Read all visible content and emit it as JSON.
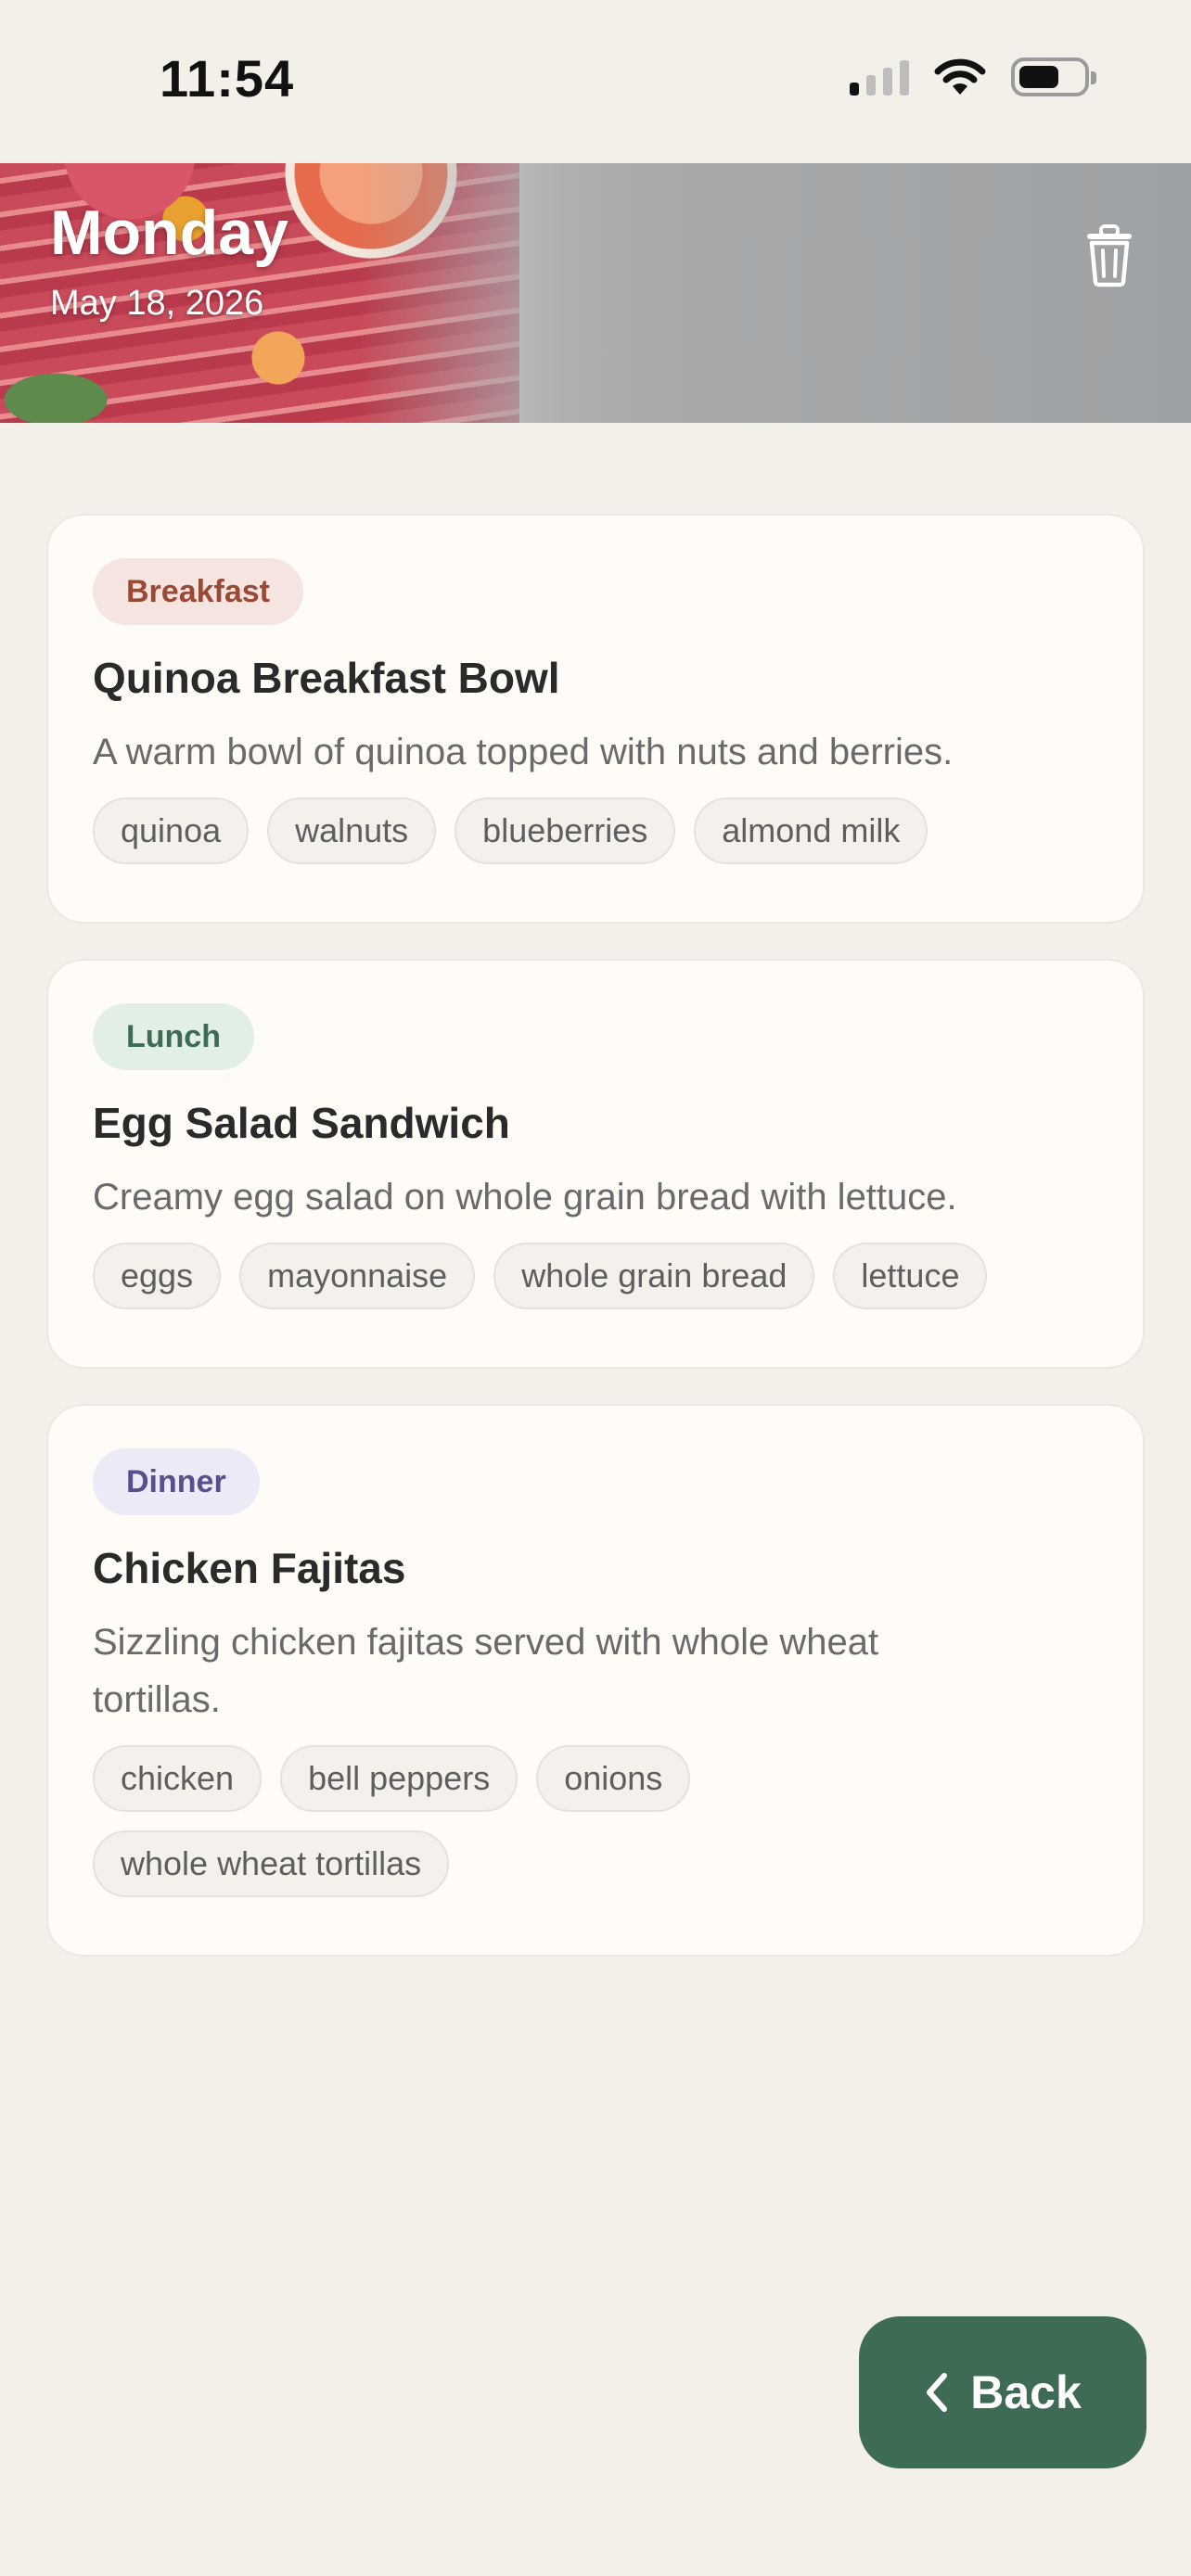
{
  "status_bar": {
    "time": "11:54"
  },
  "header": {
    "day": "Monday",
    "date": "May 18, 2026"
  },
  "meals": [
    {
      "type": "Breakfast",
      "title": "Quinoa Breakfast Bowl",
      "description": "A warm bowl of quinoa topped with nuts and berries.",
      "ingredients": [
        "quinoa",
        "walnuts",
        "blueberries",
        "almond milk"
      ]
    },
    {
      "type": "Lunch",
      "title": "Egg Salad Sandwich",
      "description": "Creamy egg salad on whole grain bread with lettuce.",
      "ingredients": [
        "eggs",
        "mayonnaise",
        "whole grain bread",
        "lettuce"
      ]
    },
    {
      "type": "Dinner",
      "title": "Chicken Fajitas",
      "description": "Sizzling chicken fajitas served with whole wheat tortillas.",
      "ingredients": [
        "chicken",
        "bell peppers",
        "onions",
        "whole wheat tortillas"
      ]
    }
  ],
  "footer": {
    "back_label": "Back"
  },
  "colors": {
    "background": "#F3F0EA",
    "card": "#FFFCF7",
    "back_button": "#3E6B53",
    "breakfast_badge_bg": "#F5E4DF",
    "breakfast_badge_text": "#9A4A34",
    "lunch_badge_bg": "#E1EFE6",
    "lunch_badge_text": "#3E6B53",
    "dinner_badge_bg": "#ECEAF7",
    "dinner_badge_text": "#5A4E8C"
  },
  "icons": {
    "delete": "trash-icon",
    "back": "chevron-left-icon"
  }
}
